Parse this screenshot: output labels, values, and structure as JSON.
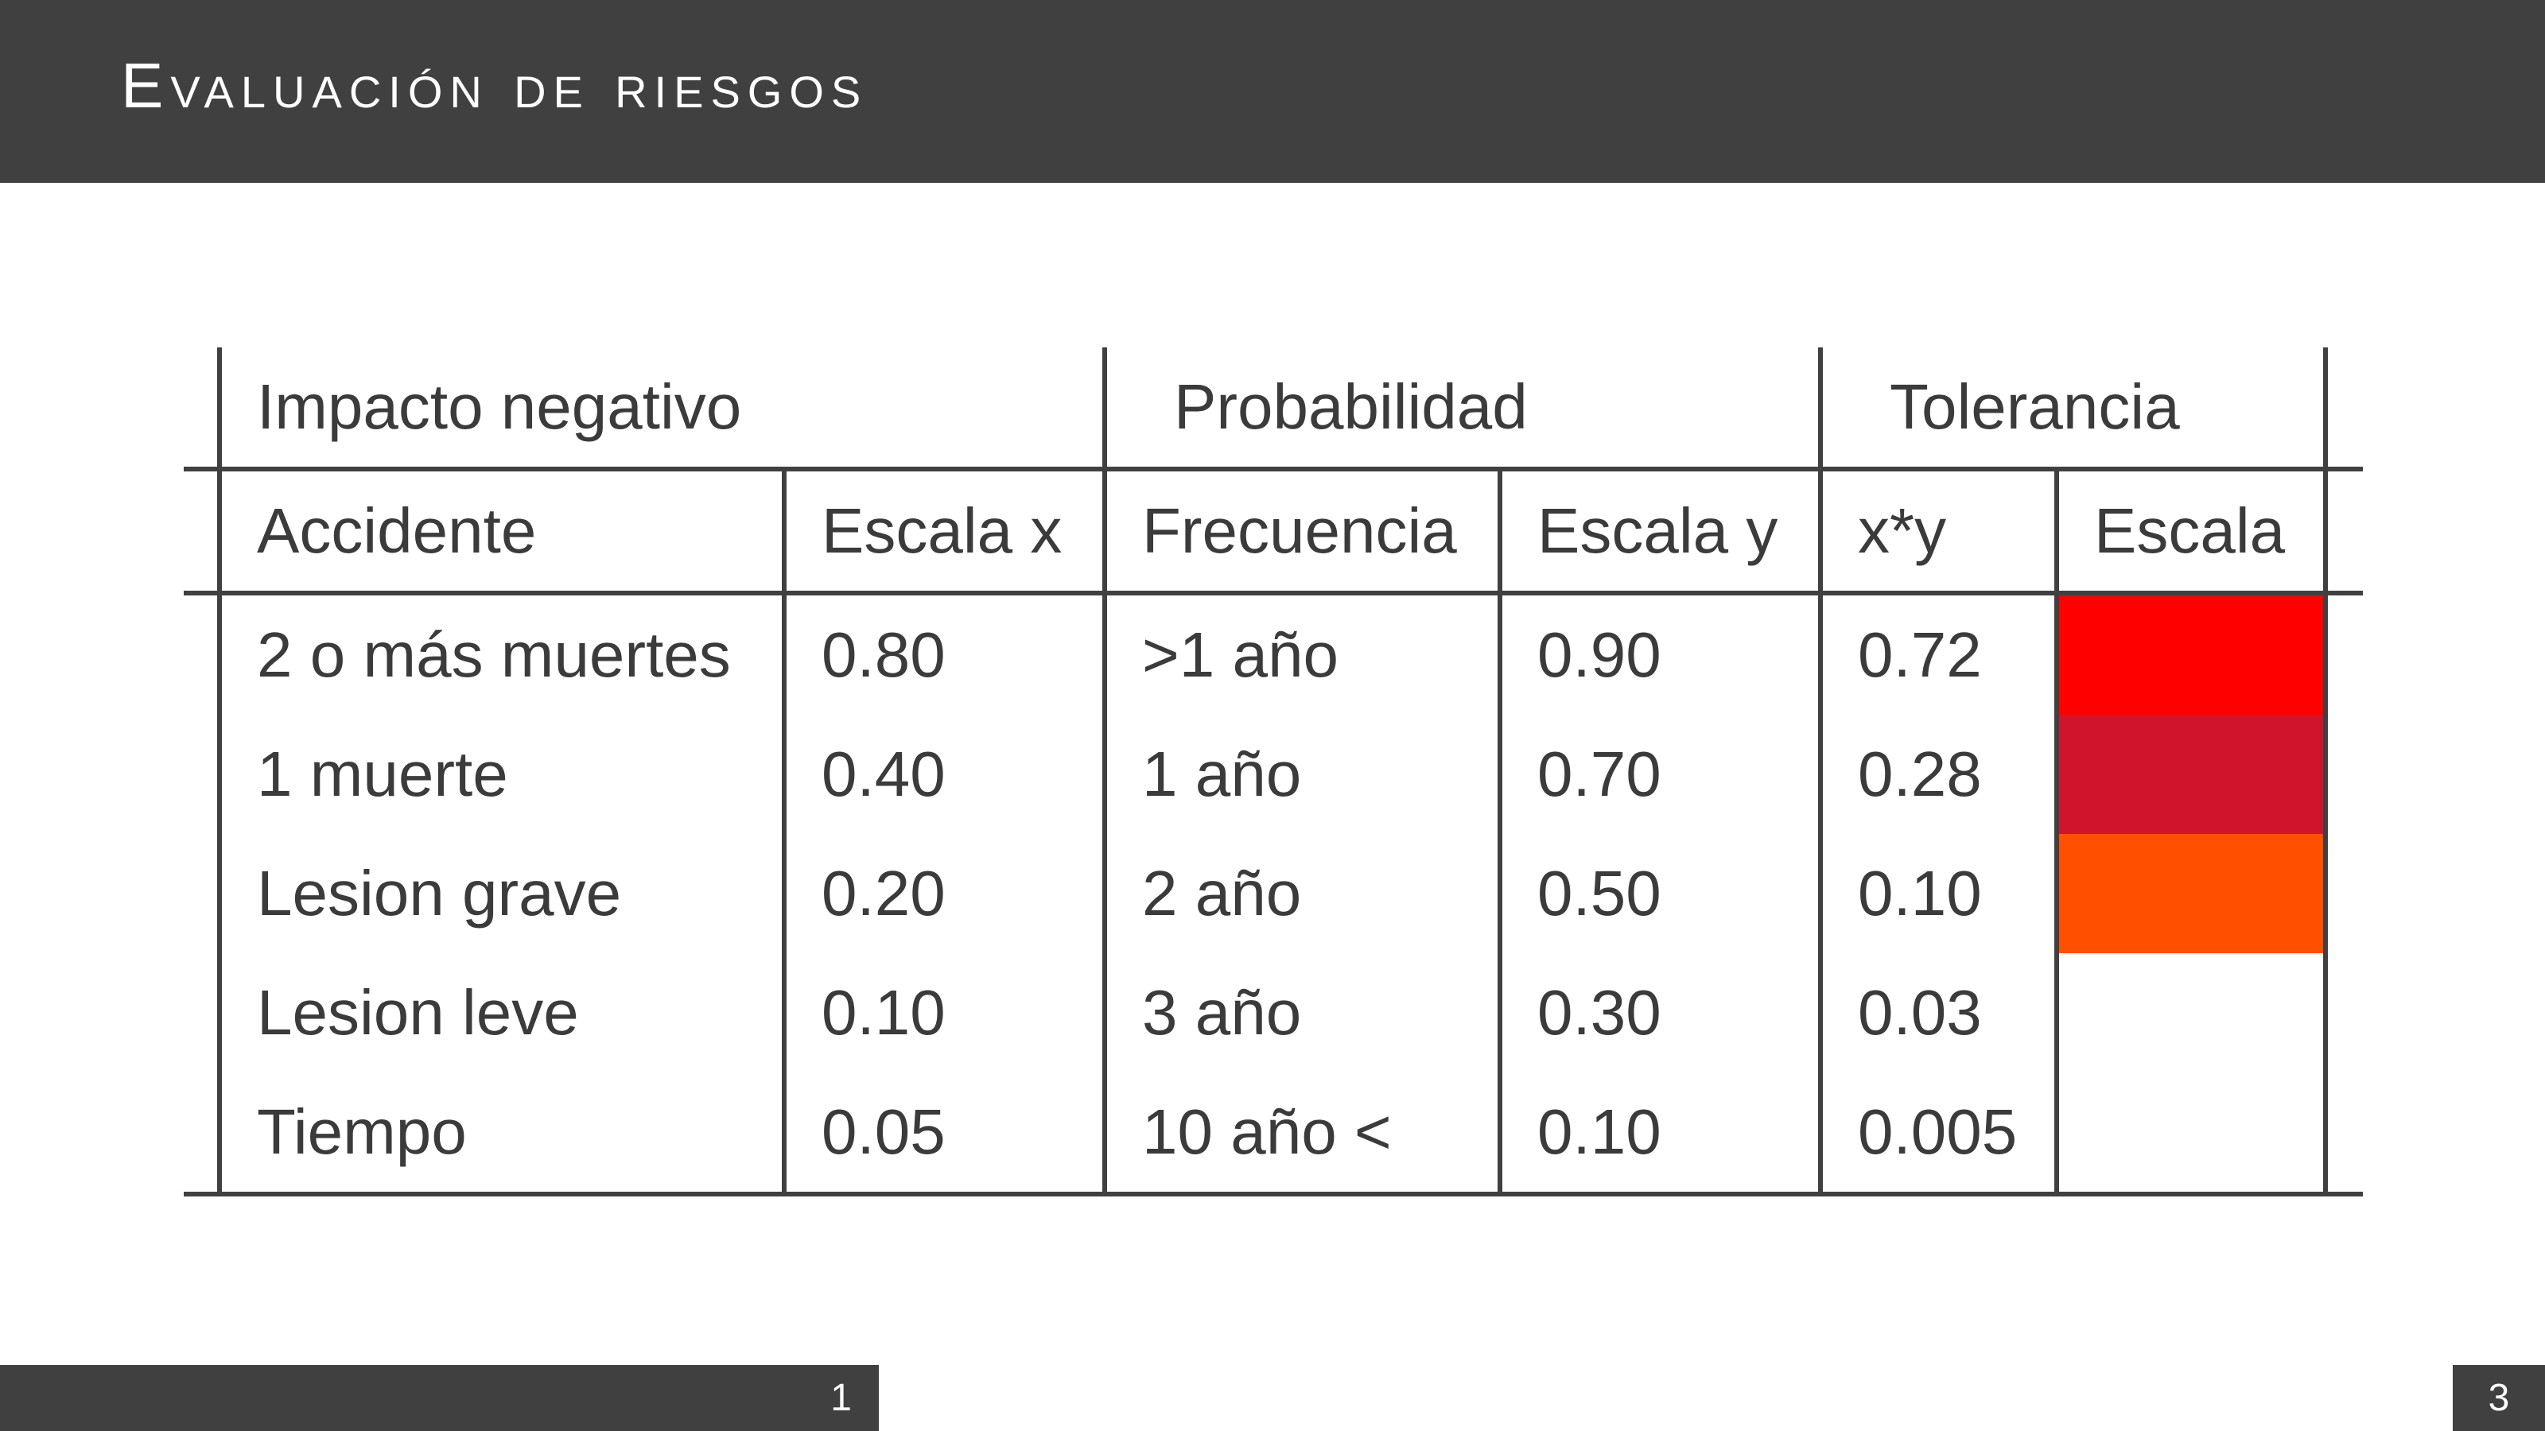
{
  "slide": {
    "title": "Evaluación de riesgos",
    "footer": {
      "current_page": "1",
      "total_pages": "3"
    }
  },
  "table": {
    "group_headers": [
      "Impacto negativo",
      "Probabilidad",
      "Tolerancia"
    ],
    "column_headers": [
      "Accidente",
      "Escala x",
      "Frecuencia",
      "Escala y",
      "x*y",
      "Escala"
    ],
    "rows": [
      {
        "accidente": "2 o más muertes",
        "escala_x": "0.80",
        "frecuencia": ">1 año",
        "escala_y": "0.90",
        "xy": "0.72",
        "color": "#ff0000"
      },
      {
        "accidente": "1 muerte",
        "escala_x": "0.40",
        "frecuencia": "1 año",
        "escala_y": "0.70",
        "xy": "0.28",
        "color": "#cf142b"
      },
      {
        "accidente": "Lesion grave",
        "escala_x": "0.20",
        "frecuencia": "2 año",
        "escala_y": "0.50",
        "xy": "0.10",
        "color": "#ff5000"
      },
      {
        "accidente": "Lesion leve",
        "escala_x": "0.10",
        "frecuencia": "3 año",
        "escala_y": "0.30",
        "xy": "0.03",
        "color": "#ffffff"
      },
      {
        "accidente": "Tiempo",
        "escala_x": "0.05",
        "frecuencia": "10 año <",
        "escala_y": "0.10",
        "xy": "0.005",
        "color": "#ffffff"
      }
    ]
  },
  "colors": {
    "dark_bar": "#404040",
    "text": "#3b3b3b",
    "background": "#ffffff"
  }
}
